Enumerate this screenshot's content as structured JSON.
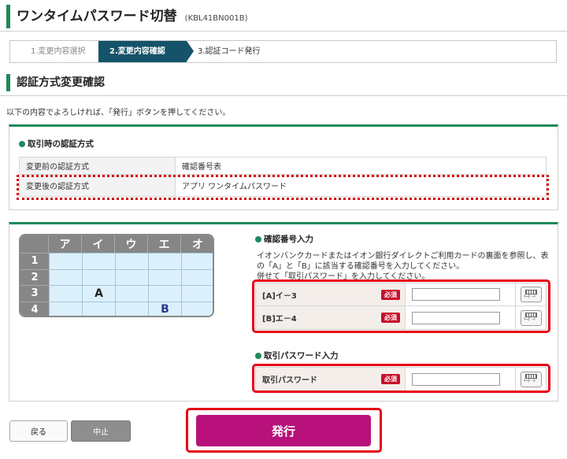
{
  "header": {
    "title": "ワンタイムパスワード切替",
    "code": "(KBL41BN001B)"
  },
  "steps": [
    {
      "label": "1.変更内容選択"
    },
    {
      "label": "2.変更内容確認"
    },
    {
      "label": "3.認証コード発行"
    }
  ],
  "section": {
    "title": "認証方式変更確認",
    "intro": "以下の内容でよろしければ、「発行」ボタンを押してください。"
  },
  "auth_method": {
    "title": "取引時の認証方式",
    "rows": [
      {
        "key": "変更前の認証方式",
        "value": "確認番号表"
      },
      {
        "key": "変更後の認証方式",
        "value": "アプリ ワンタイムパスワード"
      }
    ]
  },
  "number_grid": {
    "columns": [
      "ア",
      "イ",
      "ウ",
      "エ",
      "オ"
    ],
    "rows": [
      "1",
      "2",
      "3",
      "4"
    ],
    "markers": {
      "A": "A",
      "B": "B"
    }
  },
  "confirm_input": {
    "title": "確認番号入力",
    "desc_lines": [
      "イオンバンクカードまたはイオン銀行ダイレクトご利用カードの裏面を参照し、表",
      "の「A」と「B」に該当する確認番号を入力してください。",
      "併せて「取引パスワード」を入力してください。"
    ],
    "fields": [
      {
        "label": "[A]イ－3",
        "required": "必須",
        "value": ""
      },
      {
        "label": "[B]エ－4",
        "required": "必須",
        "value": ""
      }
    ],
    "keyboard_label": "ｷｰﾎﾞｰﾄﾞ"
  },
  "password_input": {
    "title": "取引パスワード入力",
    "field": {
      "label": "取引パスワード",
      "required": "必須",
      "value": ""
    }
  },
  "buttons": {
    "back": "戻る",
    "stop": "中止",
    "issue": "発行"
  },
  "colors": {
    "accent_green": "#1f8a5b",
    "step_active": "#14536a",
    "issue_button": "#b8117b",
    "highlight_red": "#e60012"
  }
}
